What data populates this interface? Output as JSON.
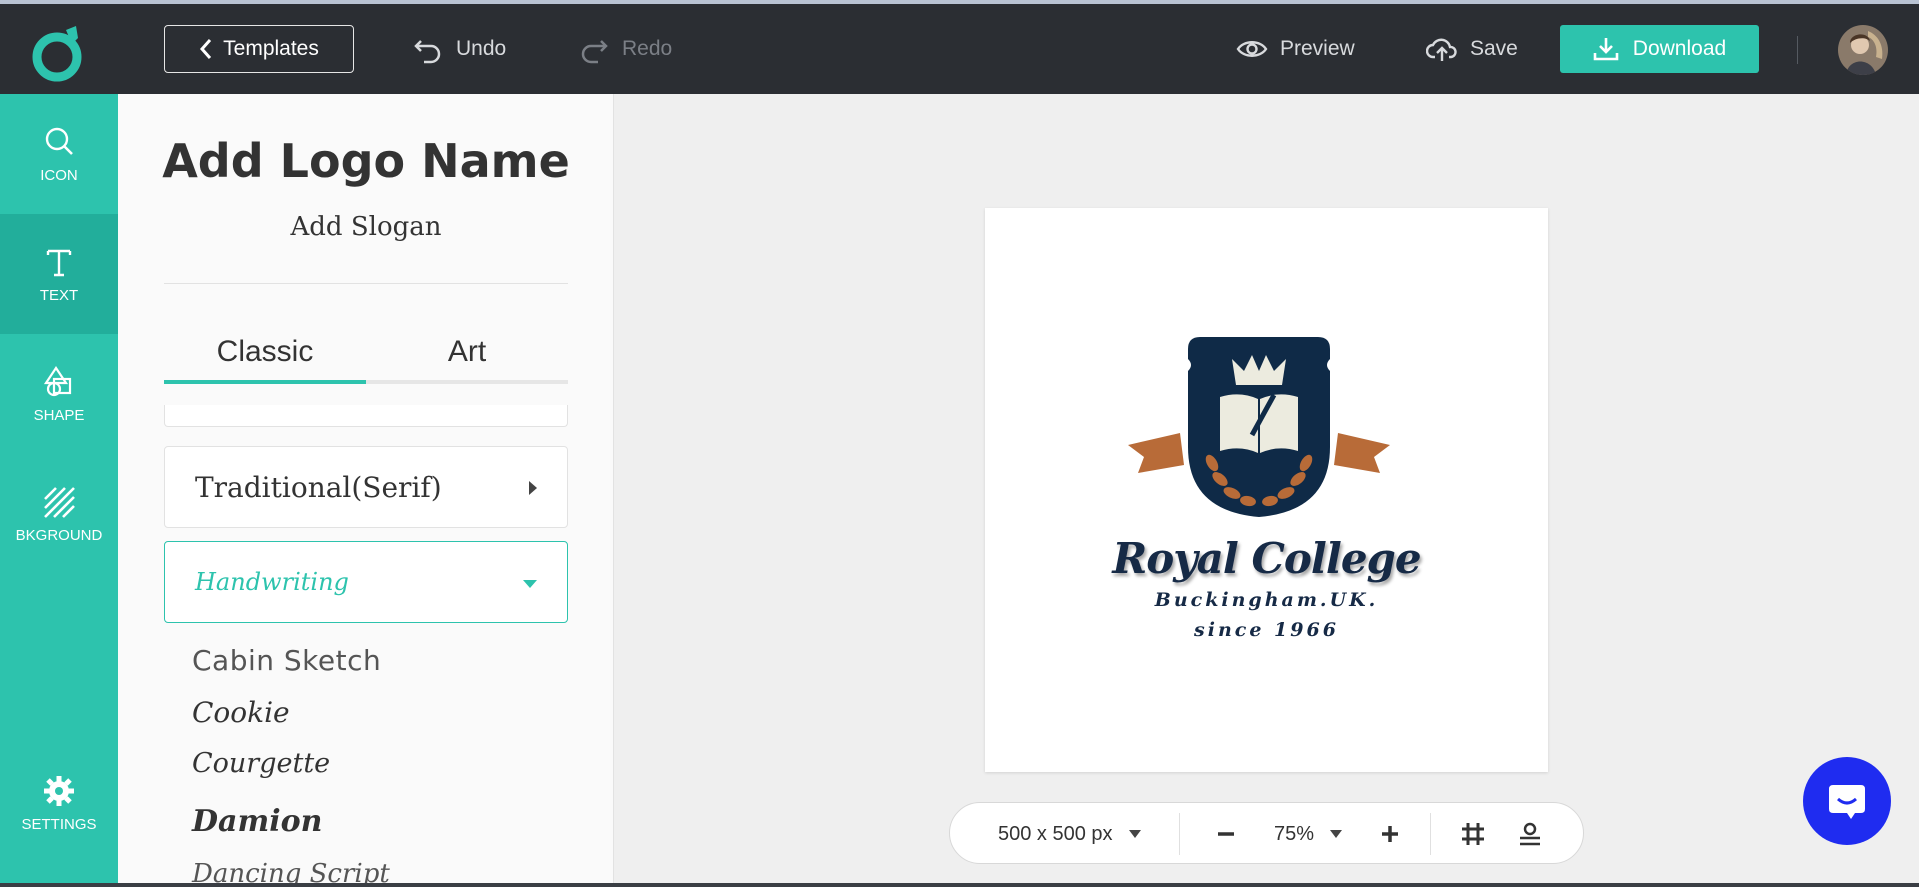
{
  "topbar": {
    "templates_label": "Templates",
    "undo_label": "Undo",
    "redo_label": "Redo",
    "preview_label": "Preview",
    "save_label": "Save",
    "download_label": "Download",
    "accent_color": "#2dc3ad"
  },
  "sidebar": {
    "items": [
      {
        "label": "ICON",
        "icon": "search-icon"
      },
      {
        "label": "TEXT",
        "icon": "text-icon"
      },
      {
        "label": "SHAPE",
        "icon": "shape-icon"
      },
      {
        "label": "BKGROUND",
        "icon": "background-icon"
      },
      {
        "label": "SETTINGS",
        "icon": "gear-icon"
      }
    ],
    "active": "TEXT"
  },
  "text_panel": {
    "logo_name": "Add Logo Name",
    "slogan": "Add Slogan",
    "tabs": [
      {
        "label": "Classic",
        "active": true
      },
      {
        "label": "Art",
        "active": false
      }
    ],
    "categories": [
      {
        "label": "Traditional(Serif)",
        "expanded": false
      },
      {
        "label": "Handwriting",
        "expanded": true
      }
    ],
    "fonts": [
      "Cabin Sketch",
      "Cookie",
      "Courgette",
      "Damion",
      "Dancing Script"
    ]
  },
  "canvas": {
    "logo_title": "Royal College",
    "logo_subtitle": "Buckingham.UK.",
    "logo_since": "since 1966",
    "size_label": "500 x 500 px",
    "zoom_label": "75%"
  }
}
